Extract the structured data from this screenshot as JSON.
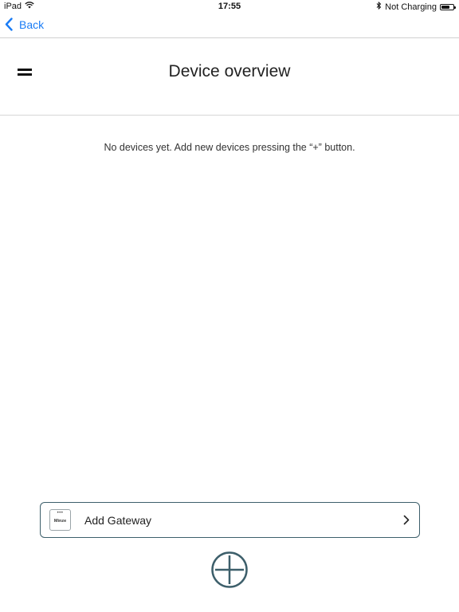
{
  "status_bar": {
    "device": "iPad",
    "time": "17:55",
    "charging_status": "Not Charging",
    "battery_level_percent": 70,
    "icons": [
      "wifi-icon",
      "bluetooth-icon",
      "battery-icon"
    ]
  },
  "nav": {
    "back_label": "Back",
    "accent_color": "#1a7cf5"
  },
  "header": {
    "title": "Device overview"
  },
  "main": {
    "empty_message": "No devices yet. Add new devices pressing the “+” button."
  },
  "gateway": {
    "label": "Add Gateway",
    "logo_dots": "•••",
    "logo_text": "Minze",
    "border_color": "#3d5f6b"
  },
  "add_button": {
    "icon": "plus-circle-icon",
    "color": "#3d5f6b"
  }
}
